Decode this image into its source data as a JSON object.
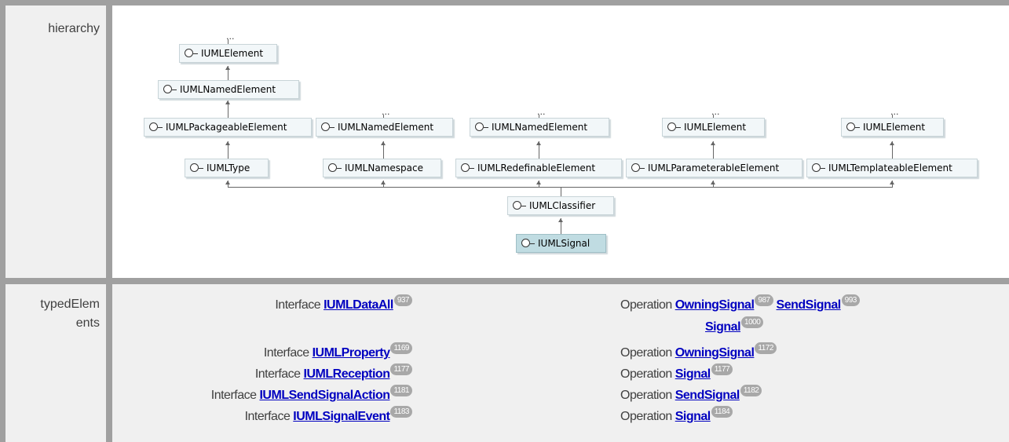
{
  "rows": {
    "hierarchy_label": "hierarchy",
    "typed_label_line1": "typedElem",
    "typed_label_line2": "ents"
  },
  "diagram": {
    "ellipsis": "...",
    "nodes": {
      "n1": "IUMLElement",
      "n2": "IUMLNamedElement",
      "n3": "IUMLPackageableElement",
      "n4": "IUMLNamedElement",
      "n5": "IUMLNamedElement",
      "n6": "IUMLElement",
      "n7": "IUMLElement",
      "n8": "IUMLType",
      "n9": "IUMLNamespace",
      "n10": "IUMLRedefinableElement",
      "n11": "IUMLParameterableElement",
      "n12": "IUMLTemplateableElement",
      "n13": "IUMLClassifier",
      "n14": "IUMLSignal"
    }
  },
  "typed_elements": {
    "left": [
      {
        "kind": "Interface",
        "name": "IUMLDataAll",
        "count": "937"
      },
      {
        "kind": "Interface",
        "name": "IUMLProperty",
        "count": "1169"
      },
      {
        "kind": "Interface",
        "name": "IUMLReception",
        "count": "1177"
      },
      {
        "kind": "Interface",
        "name": "IUMLSendSignalAction",
        "count": "1181"
      },
      {
        "kind": "Interface",
        "name": "IUMLSignalEvent",
        "count": "1183"
      }
    ],
    "right": [
      {
        "kind": "Operation",
        "items": [
          {
            "name": "OwningSignal",
            "count": "987"
          },
          {
            "name": "SendSignal",
            "count": "993"
          },
          {
            "name": "Signal",
            "count": "1000"
          }
        ]
      },
      {
        "kind": "Operation",
        "items": [
          {
            "name": "OwningSignal",
            "count": "1172"
          }
        ]
      },
      {
        "kind": "Operation",
        "items": [
          {
            "name": "Signal",
            "count": "1177"
          }
        ]
      },
      {
        "kind": "Operation",
        "items": [
          {
            "name": "SendSignal",
            "count": "1182"
          }
        ]
      },
      {
        "kind": "Operation",
        "items": [
          {
            "name": "Signal",
            "count": "1184"
          }
        ]
      }
    ]
  }
}
